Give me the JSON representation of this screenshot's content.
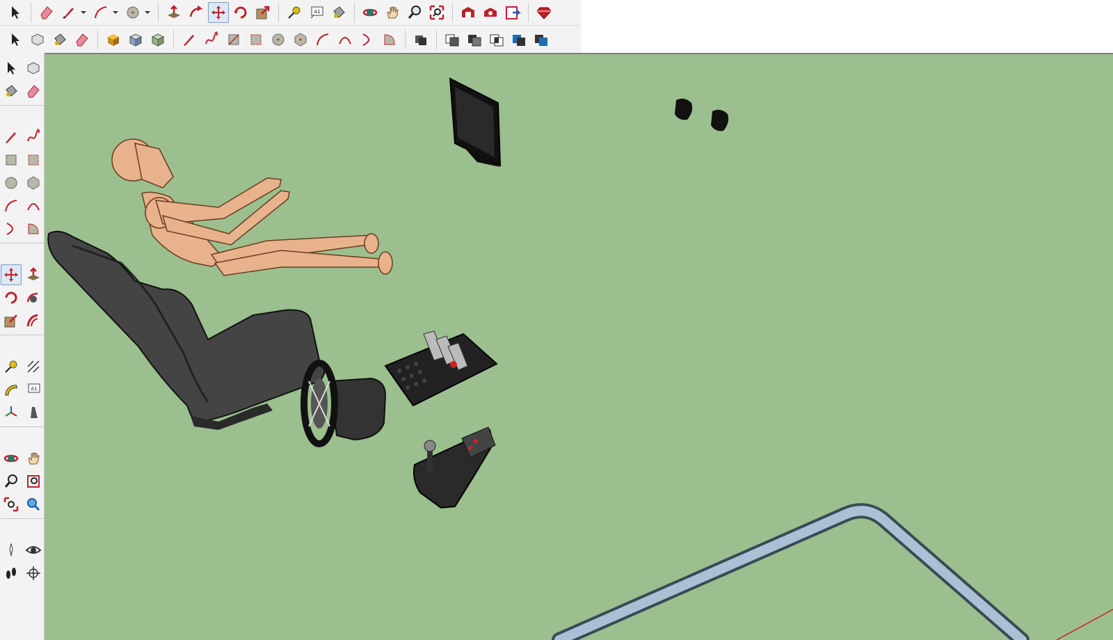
{
  "app": "SketchUp",
  "toolbar_row1": [
    {
      "name": "select",
      "icon": "select-arrow-icon"
    },
    {
      "name": "eraser",
      "icon": "eraser-icon"
    },
    {
      "name": "pencil",
      "icon": "pencil-icon",
      "dropdown": true
    },
    {
      "name": "arc",
      "icon": "arc-icon",
      "dropdown": true
    },
    {
      "name": "circle",
      "icon": "circle-icon",
      "dropdown": true
    },
    {
      "name": "push-pull",
      "icon": "push-pull-icon"
    },
    {
      "name": "follow-me",
      "icon": "follow-me-icon"
    },
    {
      "name": "move",
      "icon": "move-icon",
      "active": true
    },
    {
      "name": "rotate",
      "icon": "rotate-icon"
    },
    {
      "name": "scale",
      "icon": "scale-icon"
    },
    {
      "name": "tape-measure",
      "icon": "tape-measure-icon"
    },
    {
      "name": "text",
      "icon": "text-icon",
      "text": "A1"
    },
    {
      "name": "paint-bucket",
      "icon": "paint-bucket-icon"
    },
    {
      "name": "orbit",
      "icon": "orbit-icon"
    },
    {
      "name": "pan",
      "icon": "pan-hand-icon"
    },
    {
      "name": "zoom",
      "icon": "zoom-icon"
    },
    {
      "name": "zoom-extents",
      "icon": "zoom-extents-icon"
    },
    {
      "name": "warehouse",
      "icon": "warehouse-icon"
    },
    {
      "name": "extension-warehouse",
      "icon": "extension-warehouse-icon"
    },
    {
      "name": "send-to-layout",
      "icon": "layout-icon"
    },
    {
      "name": "extension-manager",
      "icon": "ruby-gem-icon"
    }
  ],
  "toolbar_row2": [
    "select-arrow-icon",
    "make-component-icon",
    "paint-bucket-icon",
    "eraser-icon",
    "shaded-box-icon",
    "textured-box-icon",
    "xray-box-icon",
    "line-icon",
    "freehand-icon",
    "rectangle-icon",
    "rotated-rectangle-icon",
    "circle-icon",
    "polygon-icon",
    "arc-icon",
    "two-point-arc-icon",
    "three-point-arc-icon",
    "pie-icon",
    "outliner-icon",
    "union-icon",
    "subtract-icon",
    "intersect-icon",
    "trim-icon",
    "split-icon"
  ],
  "side_text_label": "A1",
  "toolbar_text_label": "A1"
}
